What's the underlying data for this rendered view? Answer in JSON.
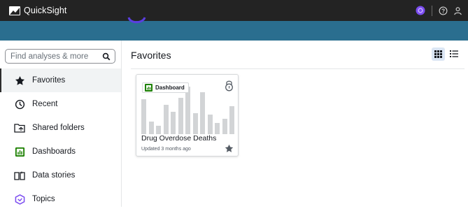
{
  "app": {
    "title": "QuickSight"
  },
  "topbar": {
    "help_icon": "help-icon",
    "user_icon": "user-icon",
    "q_icon": "q-icon"
  },
  "search": {
    "placeholder": "Find analyses & more"
  },
  "sidebar": {
    "items": [
      {
        "label": "Favorites",
        "icon": "star-icon",
        "active": true
      },
      {
        "label": "Recent",
        "icon": "clock-icon",
        "active": false
      },
      {
        "label": "Shared folders",
        "icon": "shared-folder-icon",
        "active": false
      },
      {
        "label": "Dashboards",
        "icon": "dashboard-icon",
        "active": false
      },
      {
        "label": "Data stories",
        "icon": "data-story-icon",
        "active": false
      },
      {
        "label": "Topics",
        "icon": "topics-icon",
        "active": false
      }
    ]
  },
  "main": {
    "title": "Favorites",
    "view_mode": "grid"
  },
  "cards": [
    {
      "type_label": "Dashboard",
      "title": "Drug Overdose Deaths",
      "updated": "Updated 3 months ago",
      "favorited": true
    }
  ],
  "colors": {
    "topbar": "#232323",
    "banner": "#2a6e8f",
    "dashboard_green": "#1d8102",
    "active_view_bg": "#dbe6f4",
    "q_purple": "#7b4cf0"
  }
}
